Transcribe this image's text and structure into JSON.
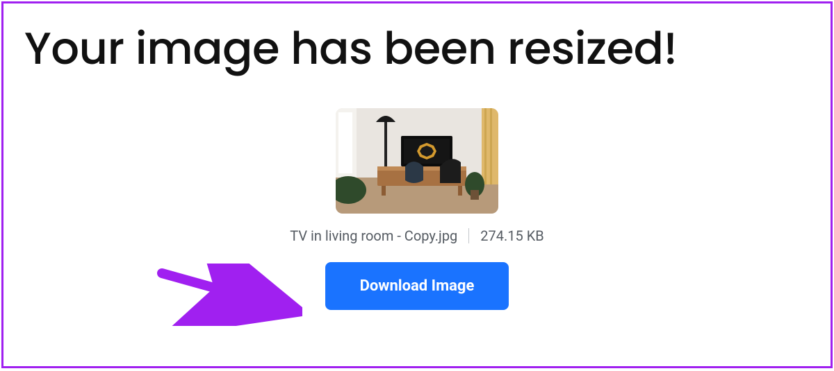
{
  "heading": "Your image has been resized!",
  "file": {
    "name": "TV in living room - Copy.jpg",
    "size": "274.15 KB"
  },
  "download_label": "Download Image",
  "annotation": {
    "arrow_color": "#a020f0"
  }
}
